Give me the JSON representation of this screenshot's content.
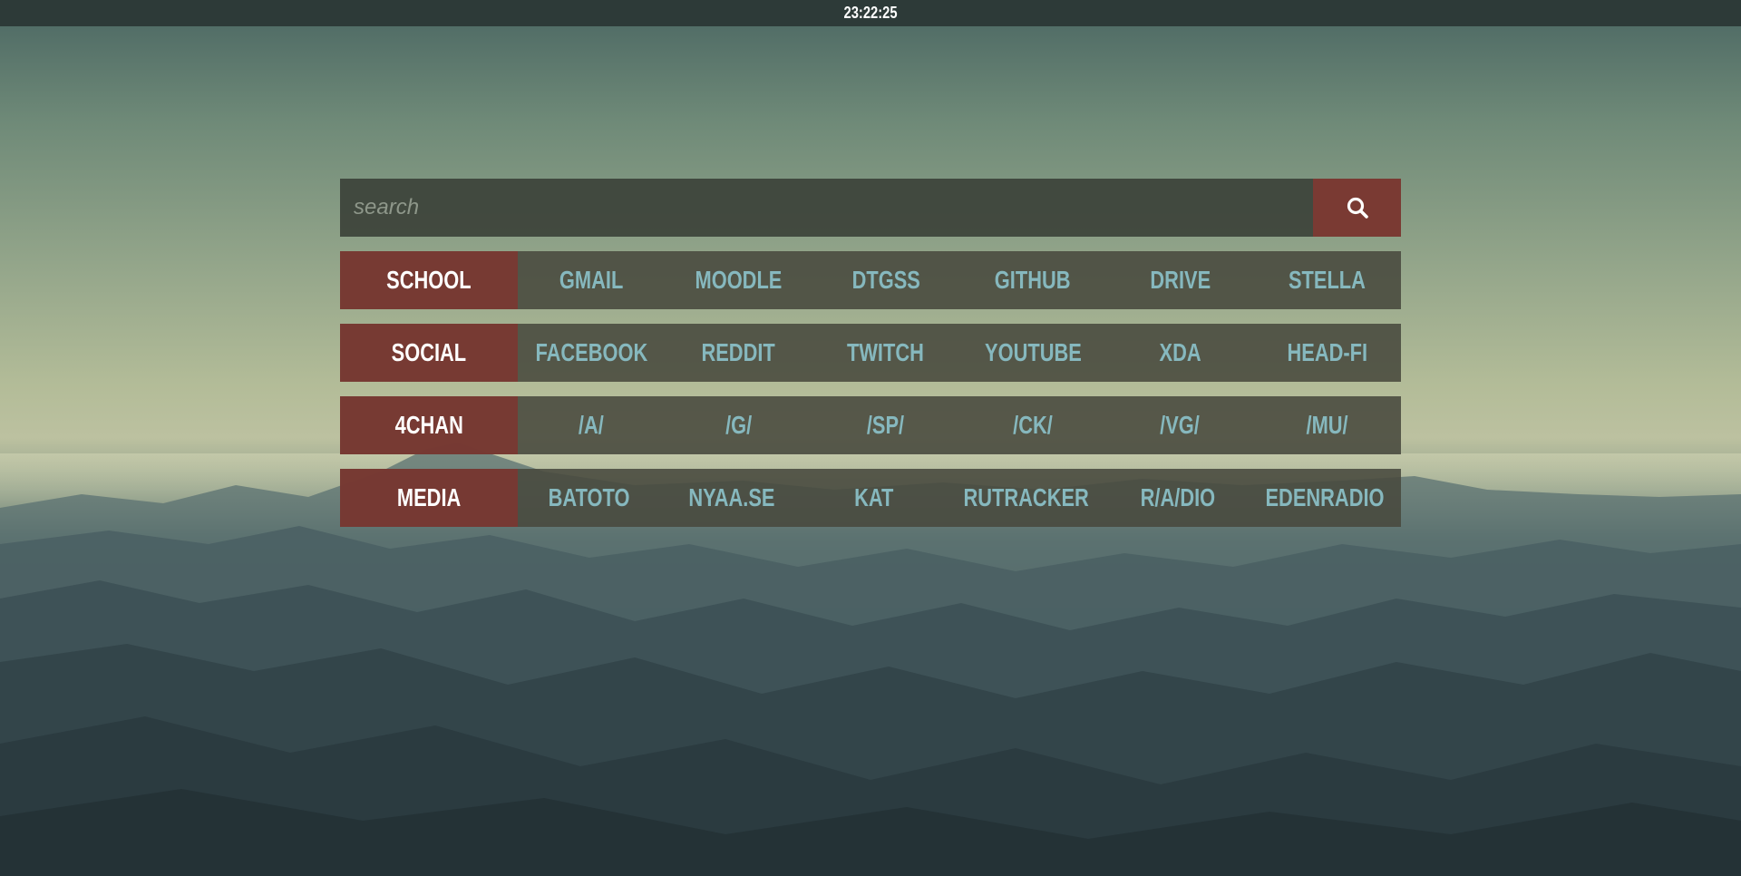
{
  "clock": "23:22:25",
  "search": {
    "placeholder": "search",
    "value": "",
    "button_icon": "search-icon"
  },
  "colors": {
    "topbar": "#2d3a38",
    "category_bg": "#7a3833",
    "row_bg": "#48493e",
    "link_text": "#86b8be",
    "category_text": "#ffffff"
  },
  "rows": [
    {
      "category": "SCHOOL",
      "links": [
        "GMAIL",
        "MOODLE",
        "DTGSS",
        "GITHUB",
        "DRIVE",
        "STELLA"
      ]
    },
    {
      "category": "SOCIAL",
      "links": [
        "FACEBOOK",
        "REDDIT",
        "TWITCH",
        "YOUTUBE",
        "XDA",
        "HEAD-FI"
      ]
    },
    {
      "category": "4CHAN",
      "links": [
        "/A/",
        "/G/",
        "/SP/",
        "/CK/",
        "/VG/",
        "/MU/"
      ]
    },
    {
      "category": "MEDIA",
      "links": [
        "BATOTO",
        "NYAA.SE",
        "KAT",
        "RUTRACKER",
        "R/A/DIO",
        "EDENRADIO"
      ]
    }
  ]
}
